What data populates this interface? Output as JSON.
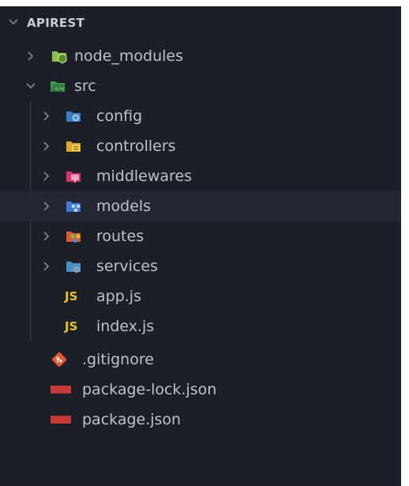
{
  "explorer": {
    "root": {
      "label": "APIREST",
      "expanded": true
    },
    "items": [
      {
        "label": "node_modules",
        "type": "folder",
        "icon": "node-folder-icon",
        "expanded": false
      },
      {
        "label": "src",
        "type": "folder",
        "icon": "src-folder-icon",
        "expanded": true
      },
      {
        "label": "config",
        "type": "folder",
        "icon": "config-folder-icon",
        "expanded": false
      },
      {
        "label": "controllers",
        "type": "folder",
        "icon": "controllers-folder-icon",
        "expanded": false
      },
      {
        "label": "middlewares",
        "type": "folder",
        "icon": "middlewares-folder-icon",
        "expanded": false
      },
      {
        "label": "models",
        "type": "folder",
        "icon": "models-folder-icon",
        "expanded": false,
        "selected": true
      },
      {
        "label": "routes",
        "type": "folder",
        "icon": "routes-folder-icon",
        "expanded": false
      },
      {
        "label": "services",
        "type": "folder",
        "icon": "services-folder-icon",
        "expanded": false
      },
      {
        "label": "app.js",
        "type": "file",
        "icon": "js-file-icon",
        "badge": "JS"
      },
      {
        "label": "index.js",
        "type": "file",
        "icon": "js-file-icon",
        "badge": "JS"
      },
      {
        "label": ".gitignore",
        "type": "file",
        "icon": "git-icon"
      },
      {
        "label": "package-lock.json",
        "type": "file",
        "icon": "npm-icon"
      },
      {
        "label": "package.json",
        "type": "file",
        "icon": "npm-icon"
      }
    ]
  },
  "colors": {
    "background": "#1b1f27",
    "selected_row": "#222731",
    "text": "#bcc2cc",
    "js_badge": "#e9c518",
    "npm_badge": "#c83a3a"
  }
}
